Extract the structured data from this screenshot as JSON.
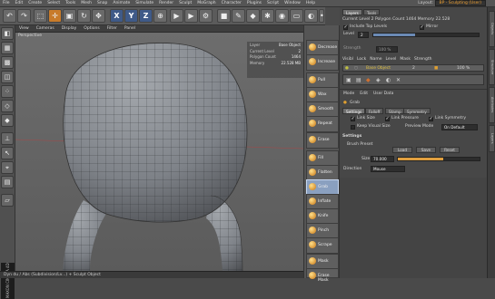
{
  "menubar": {
    "items": [
      "File",
      "Edit",
      "Create",
      "Select",
      "Tools",
      "Mesh",
      "Snap",
      "Animate",
      "Simulate",
      "Render",
      "Sculpt",
      "MoGraph",
      "Character",
      "Plugins",
      "Script",
      "Window",
      "Help"
    ],
    "layout_label": "Layout:",
    "layout_value": "BP - Sculpting (User)"
  },
  "toolbar": {
    "axis_x": "X",
    "axis_y": "Y",
    "axis_z": "Z"
  },
  "viewport": {
    "menu": [
      "View",
      "Cameras",
      "Display",
      "Options",
      "Filter",
      "Panel"
    ],
    "title": "Perspective",
    "hud": [
      {
        "k": "Layer",
        "v": "Base Object"
      },
      {
        "k": "Current Level",
        "v": "2"
      },
      {
        "k": "Polygon Count",
        "v": "1464"
      },
      {
        "k": "Memory",
        "v": "22.528 MB"
      }
    ]
  },
  "statusbar": {
    "text": "Dyn du / Abs (Subdivision/Lv...) + Sculpt Object"
  },
  "brushes": [
    {
      "label": "Decrease"
    },
    {
      "label": "Increase"
    },
    {
      "label": "Pull"
    },
    {
      "label": "Wax"
    },
    {
      "label": "Smooth"
    },
    {
      "label": "Repeat"
    },
    {
      "label": "Erase"
    },
    {
      "label": "Fill"
    },
    {
      "label": "Flatten"
    },
    {
      "label": "Grab"
    },
    {
      "label": "Inflate"
    },
    {
      "label": "Knife"
    },
    {
      "label": "Pinch"
    },
    {
      "label": "Scrape"
    },
    {
      "label": "Mask"
    },
    {
      "label": "Erase Mask"
    }
  ],
  "layers_panel": {
    "tabs": [
      "Layers",
      "Tools"
    ],
    "current_level_label": "Current Level",
    "current_level": "2",
    "polygon_count_label": "Polygon Count",
    "polygon_count": "1464",
    "memory_label": "Memory",
    "memory": "22.528",
    "include_top_levels": "Include Top Levels",
    "mirror": "Mirror",
    "level_label": "Level",
    "level_value": "2",
    "strength_label": "Strength",
    "strength_value": "100 %",
    "cols": [
      "Visibl",
      "Lock",
      "Name",
      "Level",
      "Mask",
      "Strength"
    ],
    "row_name": "Base Object",
    "row_level": "2",
    "row_strength": "100 %"
  },
  "attributes_panel": {
    "menu": [
      "Mode",
      "Edit",
      "User Data"
    ],
    "object": "Grab",
    "tabs": [
      "Settings",
      "Falloff",
      "Stamp",
      "Symmetry"
    ],
    "link_size": "Link Size",
    "link_pressure": "Link Pressure",
    "link_symmetry": "Link Symmetry",
    "keep_visual_size": "Keep Visual Size",
    "preview_mode": "Preview Mode",
    "preview_value": "On Default",
    "section": "Settings",
    "brush_preset": "Brush Preset",
    "load": "Load",
    "save": "Save",
    "reset": "Reset",
    "size_label": "Size",
    "size_value": "70.000",
    "size_fraction": 0.55,
    "direction_label": "Direction",
    "direction_value": "Mouse"
  },
  "right_tabs": [
    "Objects",
    "Structure",
    "Attributes",
    "Layers"
  ],
  "logo": "MAXON CINEMA 4D"
}
